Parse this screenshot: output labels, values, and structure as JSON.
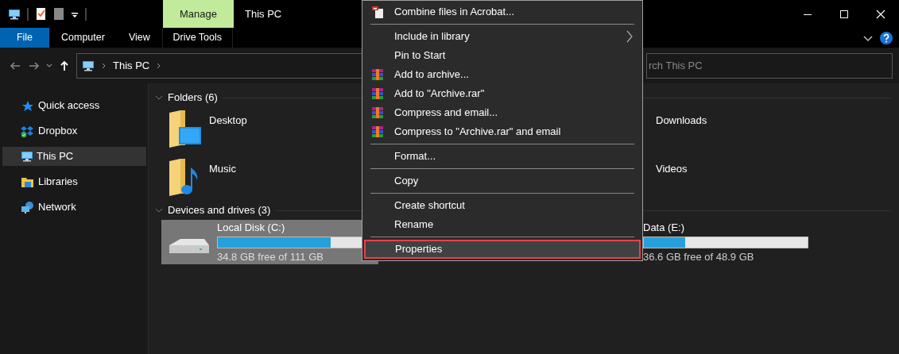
{
  "window": {
    "title": "This PC",
    "contextual_tab": "Manage"
  },
  "ribbon_tabs": [
    {
      "label": "File",
      "kind": "file"
    },
    {
      "label": "Computer",
      "kind": "tab"
    },
    {
      "label": "View",
      "kind": "tab"
    },
    {
      "label": "Drive Tools",
      "kind": "contextual"
    }
  ],
  "address_bar": {
    "path": [
      "This PC"
    ]
  },
  "search": {
    "placeholder": "rch This PC"
  },
  "sidebar": {
    "items": [
      {
        "label": "Quick access",
        "kind": "star",
        "selected": false
      },
      {
        "label": "Dropbox",
        "kind": "dropbox",
        "selected": false
      },
      {
        "label": "This PC",
        "kind": "pc",
        "selected": true
      },
      {
        "label": "Libraries",
        "kind": "libraries",
        "selected": false
      },
      {
        "label": "Network",
        "kind": "network",
        "selected": false
      }
    ]
  },
  "folders": {
    "title": "Folders (6)",
    "items": [
      {
        "label": "Desktop",
        "kind": "desktop"
      },
      {
        "label": "Downloads",
        "kind": "covered"
      },
      {
        "label": "Music",
        "kind": "music"
      },
      {
        "label": "Videos",
        "kind": "covered"
      }
    ]
  },
  "drives": {
    "title": "Devices and drives (3)",
    "items": [
      {
        "label": "Local Disk (C:)",
        "free": "34.8 GB free of 111 GB",
        "level": 0.69,
        "selected": true,
        "kind": "disk"
      },
      {
        "label": "Data (E:)",
        "free": "36.6 GB free of 48.9 GB",
        "level": 0.25,
        "selected": false,
        "kind": "covered"
      }
    ]
  },
  "context_menu": {
    "groups": [
      [
        {
          "label": "Combine files in Acrobat...",
          "kind": "acrobat",
          "submenu": false,
          "selected": false
        }
      ],
      [
        {
          "label": "Include in library",
          "kind": "text",
          "submenu": true,
          "selected": false
        },
        {
          "label": "Pin to Start",
          "kind": "text",
          "submenu": false,
          "selected": false
        },
        {
          "label": "Add to archive...",
          "kind": "rar",
          "submenu": false,
          "selected": false
        },
        {
          "label": "Add to \"Archive.rar\"",
          "kind": "rar",
          "submenu": false,
          "selected": false
        },
        {
          "label": "Compress and email...",
          "kind": "rar",
          "submenu": false,
          "selected": false
        },
        {
          "label": "Compress to \"Archive.rar\" and email",
          "kind": "rar",
          "submenu": false,
          "selected": false
        }
      ],
      [
        {
          "label": "Format...",
          "kind": "text",
          "submenu": false,
          "selected": false
        }
      ],
      [
        {
          "label": "Copy",
          "kind": "text",
          "submenu": false,
          "selected": false
        }
      ],
      [
        {
          "label": "Create shortcut",
          "kind": "text",
          "submenu": false,
          "selected": false
        },
        {
          "label": "Rename",
          "kind": "text",
          "submenu": false,
          "selected": false
        }
      ],
      [
        {
          "label": "Properties",
          "kind": "text",
          "submenu": false,
          "selected": true
        }
      ]
    ]
  }
}
